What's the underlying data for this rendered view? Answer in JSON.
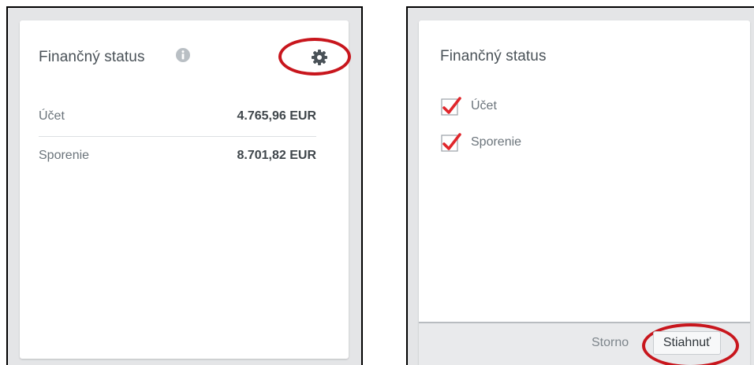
{
  "left_panel": {
    "title": "Finančný status",
    "info_icon": "info-circle-icon",
    "settings_icon": "gear-icon",
    "rows": [
      {
        "label": "Účet",
        "value": "4.765,96 EUR"
      },
      {
        "label": "Sporenie",
        "value": "8.701,82 EUR"
      }
    ]
  },
  "right_panel": {
    "title": "Finančný status",
    "options": [
      {
        "label": "Účet",
        "checked": true
      },
      {
        "label": "Sporenie",
        "checked": true
      }
    ],
    "footer": {
      "cancel_label": "Storno",
      "download_label": "Stiahnuť"
    }
  },
  "colors": {
    "highlight": "#c8161d",
    "checkmark": "#e0262b",
    "frame_border": "#000000"
  }
}
